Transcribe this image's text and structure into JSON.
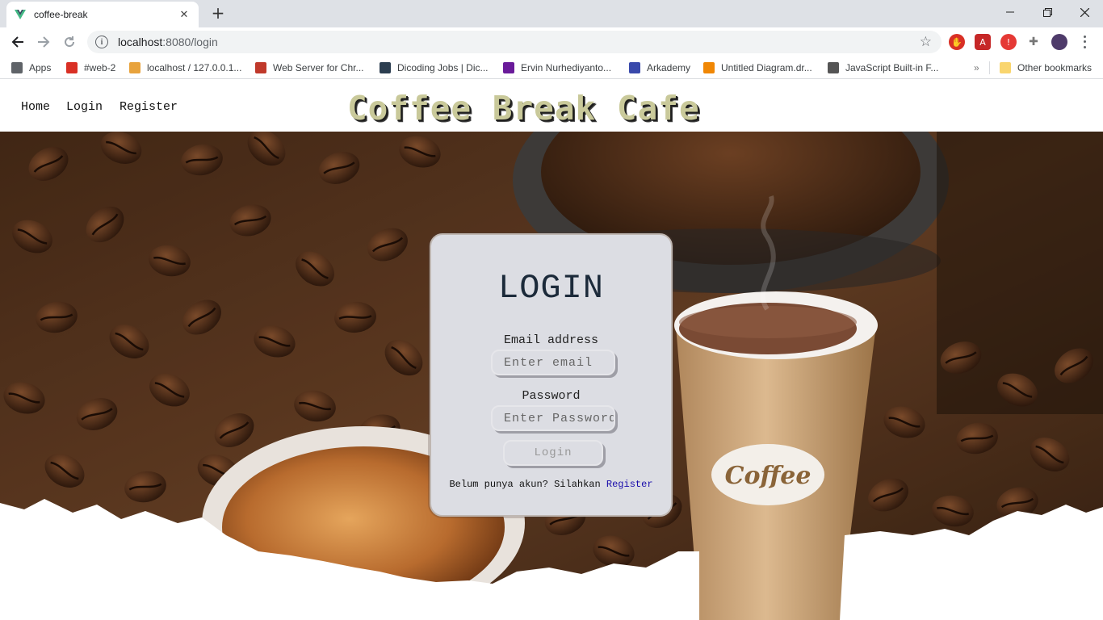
{
  "browser": {
    "tab_title": "coffee-break",
    "url_host": "localhost",
    "url_rest": ":8080/login",
    "bookmarks": [
      {
        "label": "Apps",
        "icon": "apps-grid-icon",
        "color": "#5f6368"
      },
      {
        "label": "#web-2",
        "icon": "web2-icon",
        "color": "#d93025"
      },
      {
        "label": "localhost / 127.0.0.1...",
        "icon": "phpmyadmin-icon",
        "color": "#e8a33d"
      },
      {
        "label": "Web Server for Chr...",
        "icon": "web-server-icon",
        "color": "#c0392b"
      },
      {
        "label": "Dicoding Jobs | Dic...",
        "icon": "dicoding-icon",
        "color": "#2c3e50"
      },
      {
        "label": "Ervin Nurhediyanto...",
        "icon": "profile-icon",
        "color": "#6a1b9a"
      },
      {
        "label": "Arkademy",
        "icon": "arkademy-icon",
        "color": "#3949ab"
      },
      {
        "label": "Untitled Diagram.dr...",
        "icon": "drawio-icon",
        "color": "#f08705"
      },
      {
        "label": "JavaScript Built-in F...",
        "icon": "js-icon",
        "color": "#555555"
      }
    ],
    "other_bookmarks": "Other bookmarks",
    "chevron": "»"
  },
  "nav": {
    "links": [
      "Home",
      "Login",
      "Register"
    ],
    "brand": "Coffee Break Cafe"
  },
  "login": {
    "heading": "LOGIN",
    "email_label": "Email address",
    "email_placeholder": "Enter email",
    "password_label": "Password",
    "password_placeholder": "Enter Password",
    "button": "Login",
    "note_text": "Belum punya akun? Silahkan ",
    "note_link": "Register"
  },
  "decor": {
    "cup_label": "Coffee"
  },
  "colors": {
    "chrome_tabstrip": "#dee1e6",
    "card_bg": "#dcdde3",
    "link": "#1a0dab",
    "brand": "#c9c99a"
  }
}
